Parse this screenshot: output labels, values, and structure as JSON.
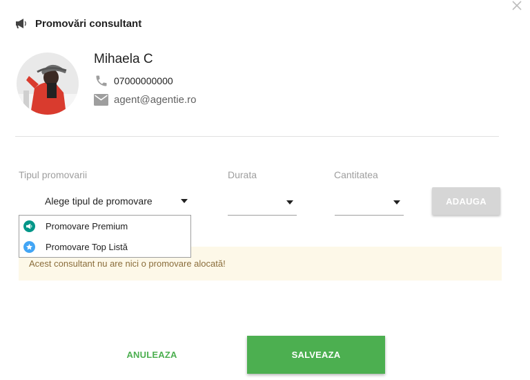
{
  "dialog": {
    "title": "Promovări consultant",
    "close_icon": "close-icon"
  },
  "agent": {
    "name": "Mihaela C",
    "phone": "07000000000",
    "email": "agent@agentie.ro"
  },
  "form": {
    "type_label": "Tipul promovarii",
    "type_value": "Alege tipul de promovare",
    "duration_label": "Durata",
    "duration_value": "",
    "quantity_label": "Cantitatea",
    "quantity_value": "",
    "add_label": "ADAUGA"
  },
  "dropdown": {
    "options": [
      {
        "label": "Promovare Premium",
        "icon": "megaphone-icon",
        "color": "#009688"
      },
      {
        "label": "Promovare Top Listă",
        "icon": "star-icon",
        "color": "#42a5f5"
      }
    ]
  },
  "alert": {
    "message": "Acest consultant nu are nici o promovare alocată!"
  },
  "actions": {
    "cancel_label": "ANULEAZA",
    "save_label": "SALVEAZA"
  },
  "colors": {
    "accent": "#4caf50",
    "add_disabled": "#d6d6d6",
    "alert_bg": "#fdf8e8",
    "alert_text": "#8a6d3b"
  }
}
